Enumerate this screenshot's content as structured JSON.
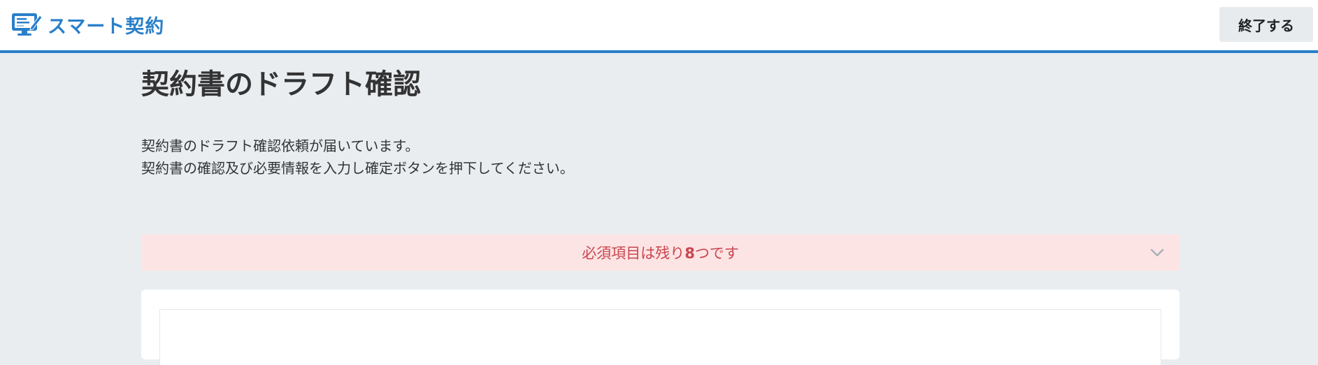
{
  "header": {
    "logo_text": "スマート契約",
    "logo_icon": "contract-monitor-icon",
    "exit_label": "終了する",
    "accent_color": "#2a7fc9"
  },
  "main": {
    "title": "契約書のドラフト確認",
    "description_line1": "契約書のドラフト確認依頼が届いています。",
    "description_line2": "契約書の確認及び必要情報を入力し確定ボタンを押下してください。"
  },
  "required_banner": {
    "prefix": "必須項目は残り",
    "count": "8",
    "suffix": "つです",
    "text_color": "#c9454f",
    "background_color": "#fde4e4",
    "toggle_icon": "chevron-down-icon"
  }
}
